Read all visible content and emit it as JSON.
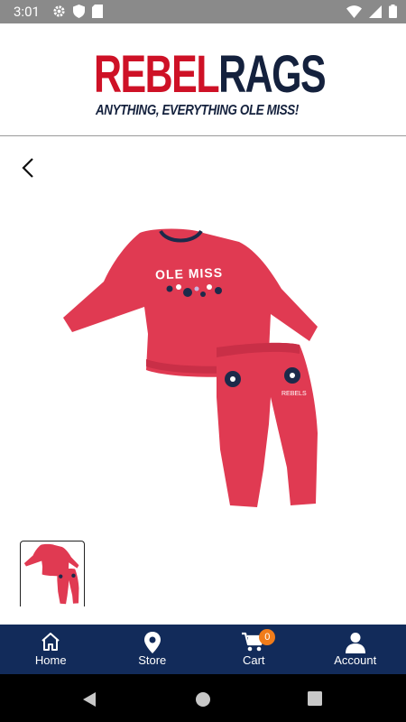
{
  "status": {
    "time": "3:01"
  },
  "brand": {
    "part1": "REBEL",
    "part2": "RAGS",
    "tagline": "ANYTHING, EVERYTHING OLE MISS!"
  },
  "product": {
    "print_text": "OLE MISS",
    "pants_text": "REBELS"
  },
  "nav": {
    "home": "Home",
    "store": "Store",
    "cart": "Cart",
    "cart_count": "0",
    "account": "Account"
  },
  "colors": {
    "brand_red": "#ce1126",
    "brand_navy": "#14213d",
    "nav_bg": "#122b5a",
    "badge": "#f07c1a",
    "garment": "#e03a52"
  }
}
